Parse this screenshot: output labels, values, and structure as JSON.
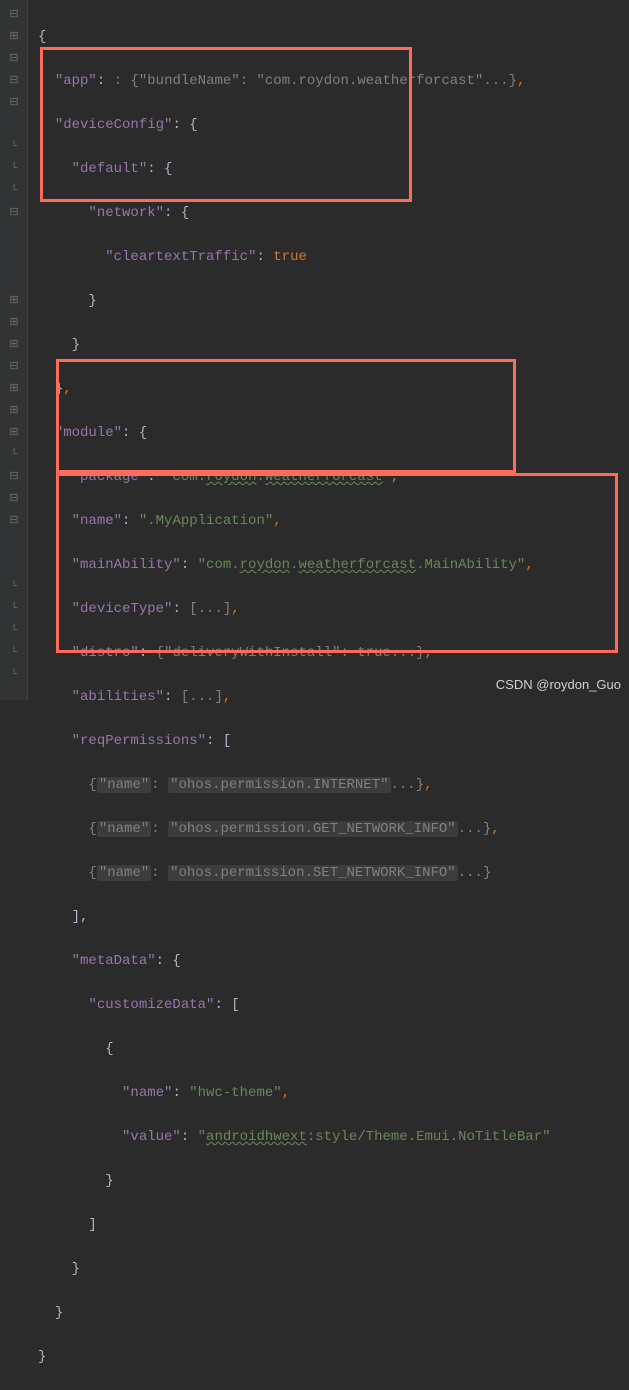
{
  "gutter": {
    "fold": "⊟",
    "foldA": "⊞",
    "line": "⊟",
    "end": "└"
  },
  "code": {
    "l1": "{",
    "app_key": "\"app\"",
    "app_val_pre": ": {",
    "bundleName_key": "\"bundleName\"",
    "bundleName_val": "\"com.roydon.weatherforcast\"",
    "dots": "...",
    "brace_close_comma": "},",
    "deviceConfig_key": "\"deviceConfig\"",
    "colon_brace": ": {",
    "default_key": "\"default\"",
    "network_key": "\"network\"",
    "cleartext_key": "\"cleartextTraffic\"",
    "true_kw": "true",
    "close_brace": "}",
    "module_key": "\"module\"",
    "package_key": "\"package\"",
    "package_val_pre": "\"com.",
    "package_val_mid1": "roydon",
    "package_val_dot": ".",
    "package_val_mid2": "weatherforcast",
    "package_val_end": "\"",
    "comma": ",",
    "name_key": "\"name\"",
    "name_val": "\".MyApplication\"",
    "mainAbility_key": "\"mainAbility\"",
    "mainAbility_val_pre": "\"com.",
    "mainAbility_val_end": ".MainAbility\"",
    "deviceType_key": "\"deviceType\"",
    "arr_collapsed": "[...]",
    "distro_key": "\"distro\"",
    "distro_val": "{\"deliveryWithInstall\": true...}",
    "abilities_key": "\"abilities\"",
    "reqPerms_key": "\"reqPermissions\"",
    "colon_bracket": ": [",
    "perm1_key": "\"name\"",
    "perm1_val": "\"ohos.permission.INTERNET\"",
    "perm2_val": "\"ohos.permission.GET_NETWORK_INFO\"",
    "perm3_val": "\"ohos.permission.SET_NETWORK_INFO\"",
    "close_bracket_comma": "],",
    "metaData_key": "\"metaData\"",
    "customize_key": "\"customizeData\"",
    "hwc_val": "\"hwc-theme\"",
    "value_key": "\"value\"",
    "value_val_pre": "\"",
    "value_val_mid": "androidhwext",
    "value_val_end": ":style/Theme.Emui.NoTitleBar\"",
    "close_bracket": "]"
  },
  "watermark": "CSDN @roydon_Guo"
}
